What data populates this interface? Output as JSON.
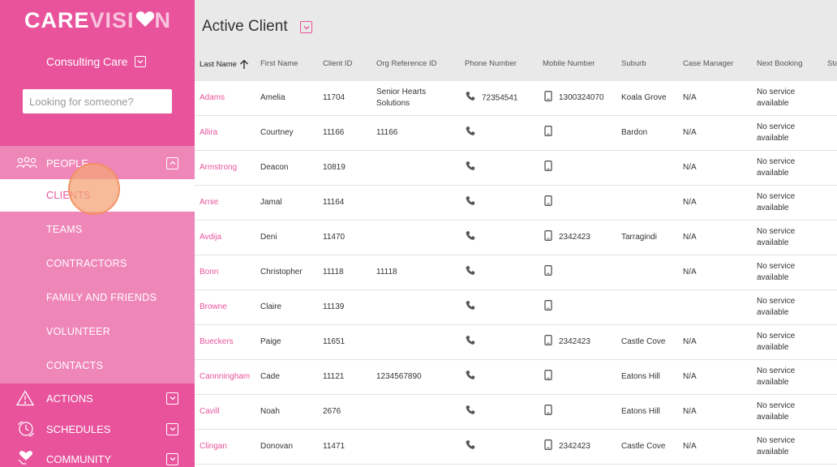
{
  "brand": {
    "care": "CARE",
    "vision": "VISI",
    "tail": "N",
    "pink": "#e8539c"
  },
  "org": {
    "name": "Consulting Care"
  },
  "search": {
    "placeholder": "Looking for someone?"
  },
  "nav": {
    "people": "PEOPLE",
    "people_items": [
      "CLIENTS",
      "TEAMS",
      "CONTRACTORS",
      "FAMILY AND FRIENDS",
      "VOLUNTEER",
      "CONTACTS"
    ],
    "actions": "ACTIONS",
    "schedules": "SCHEDULES",
    "community": "COMMUNITY"
  },
  "main": {
    "title": "Active Client",
    "columns": [
      "Last Name",
      "First Name",
      "Client ID",
      "Org Reference ID",
      "Phone Number",
      "Mobile Number",
      "Suburb",
      "Case Manager",
      "Next Booking",
      "Sta"
    ]
  },
  "rows": [
    {
      "last": "Adams",
      "first": "Amelia",
      "id": "11704",
      "org": "Senior Hearts Solutions",
      "phone": "72354541",
      "mobile": "1300324070",
      "suburb": "Koala Grove",
      "cm": "N/A",
      "next": "No service available"
    },
    {
      "last": "Allira",
      "first": "Courtney",
      "id": "11166",
      "org": "11166",
      "phone": "",
      "mobile": "",
      "suburb": "Bardon",
      "cm": "N/A",
      "next": "No service available"
    },
    {
      "last": "Armstrong",
      "first": "Deacon",
      "id": "10819",
      "org": "",
      "phone": "",
      "mobile": "",
      "suburb": "",
      "cm": "N/A",
      "next": "No service available"
    },
    {
      "last": "Arnie",
      "first": "Jamal",
      "id": "11164",
      "org": "",
      "phone": "",
      "mobile": "",
      "suburb": "",
      "cm": "N/A",
      "next": "No service available"
    },
    {
      "last": "Avdija",
      "first": "Deni",
      "id": "11470",
      "org": "",
      "phone": "",
      "mobile": "2342423",
      "suburb": "Tarragindi",
      "cm": "N/A",
      "next": "No service available"
    },
    {
      "last": "Bonn",
      "first": "Christopher",
      "id": "11118",
      "org": "11118",
      "phone": "",
      "mobile": "",
      "suburb": "",
      "cm": "N/A",
      "next": "No service available"
    },
    {
      "last": "Browne",
      "first": "Claire",
      "id": "11139",
      "org": "",
      "phone": "",
      "mobile": "",
      "suburb": "",
      "cm": "",
      "next": "No service available"
    },
    {
      "last": "Bueckers",
      "first": "Paige",
      "id": "11651",
      "org": "",
      "phone": "",
      "mobile": "2342423",
      "suburb": "Castle Cove",
      "cm": "N/A",
      "next": "No service available"
    },
    {
      "last": "Cannningham",
      "first": "Cade",
      "id": "11121",
      "org": "1234567890",
      "phone": "",
      "mobile": "",
      "suburb": "Eatons Hill",
      "cm": "N/A",
      "next": "No service available"
    },
    {
      "last": "Cavill",
      "first": "Noah",
      "id": "2676",
      "org": "",
      "phone": "",
      "mobile": "",
      "suburb": "Eatons Hill",
      "cm": "N/A",
      "next": "No service available"
    },
    {
      "last": "Clingan",
      "first": "Donovan",
      "id": "11471",
      "org": "",
      "phone": "",
      "mobile": "2342423",
      "suburb": "Castle Cove",
      "cm": "N/A",
      "next": "No service available"
    }
  ]
}
